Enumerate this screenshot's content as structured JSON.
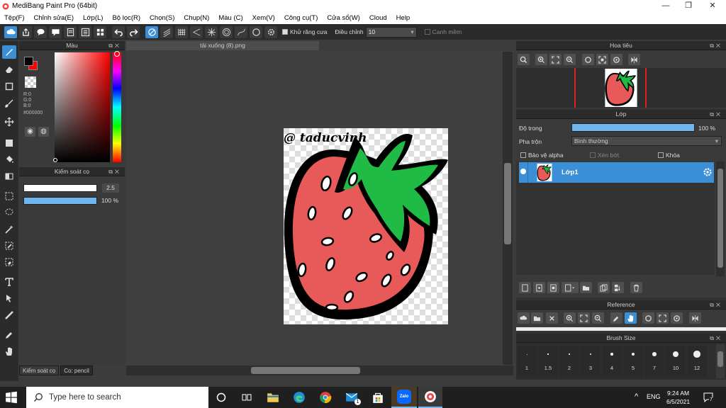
{
  "window": {
    "title": "MediBang Paint Pro (64bit)",
    "minimize": "—",
    "maximize": "❐",
    "close": "✕"
  },
  "menu": [
    "Tệp(F)",
    "Chỉnh sửa(E)",
    "Lớp(L)",
    "Bộ lọc(R)",
    "Chọn(S)",
    "Chụp(N)",
    "Màu (C)",
    "Xem(V)",
    "Công cụ(T)",
    "Cửa sổ(W)",
    "Cloud",
    "Help"
  ],
  "toolbar": {
    "antialias_label": "Khử răng cưa",
    "adjust_label": "Điều chỉnh",
    "adjust_value": "10",
    "snap_label": "Canh mềm"
  },
  "color_panel": {
    "title": "Màu",
    "r": "R:0",
    "g": "G:0",
    "b": "B:0",
    "hex": "#000000",
    "fg_color": "#000000",
    "bg_color": "#ff0000"
  },
  "brush_control": {
    "title": "Kiểm soát cọ",
    "size_value": "2.5",
    "opacity_value": "100 %",
    "size_level": 0.98,
    "opacity_level": 1.0
  },
  "bottom_tabs": [
    "Kiểm soát cọ",
    "Co: pencil"
  ],
  "document": {
    "tab_title": "tải xuống (8).png",
    "watermark": "@ taducvinh"
  },
  "navigator": {
    "title": "Hoa tiêu"
  },
  "layer_panel": {
    "title": "Lớp",
    "opacity_label": "Độ trong",
    "opacity_value": "100 %",
    "opacity_level": 1.0,
    "blend_label": "Pha trộn",
    "blend_value": "Bình thường",
    "protect_alpha": "Bảo vệ alpha",
    "clipping": "Xén bớt",
    "lock": "Khóa",
    "layer_name": "Lớp1"
  },
  "reference": {
    "title": "Reference"
  },
  "brush_size": {
    "title": "Brush Size",
    "sizes": [
      "1",
      "1.5",
      "2",
      "3",
      "4",
      "5",
      "7",
      "10",
      "12"
    ]
  },
  "taskbar": {
    "search_placeholder": "Type here to search",
    "lang": "ENG",
    "time": "9:24 AM",
    "date": "6/5/2021",
    "notif_count": "7",
    "mail_badge": "1",
    "zalo_label": "Zalo"
  }
}
